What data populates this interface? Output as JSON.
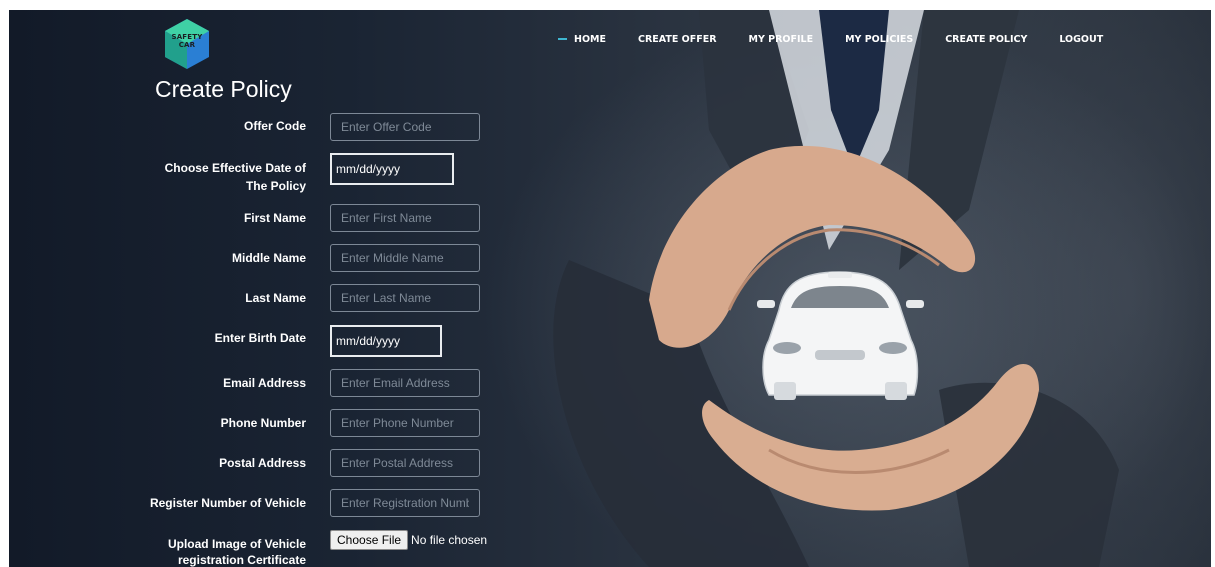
{
  "brand": {
    "logo_text_line1": "SAFETY",
    "logo_text_line2": "CAR"
  },
  "nav": {
    "items": [
      {
        "label": "HOME",
        "active": true
      },
      {
        "label": "CREATE OFFER",
        "active": false
      },
      {
        "label": "MY PROFILE",
        "active": false
      },
      {
        "label": "MY POLICIES",
        "active": false
      },
      {
        "label": "CREATE POLICY",
        "active": false
      },
      {
        "label": "LOGOUT",
        "active": false
      }
    ]
  },
  "page": {
    "title": "Create Policy"
  },
  "form": {
    "offer_code": {
      "label": "Offer Code",
      "placeholder": "Enter Offer Code"
    },
    "effective_date": {
      "label_line1": "Choose Effective Date of",
      "label_line2": "The Policy",
      "value": "mm/dd/yyyy"
    },
    "first_name": {
      "label": "First Name",
      "placeholder": "Enter First Name"
    },
    "middle_name": {
      "label": "Middle Name",
      "placeholder": "Enter Middle Name"
    },
    "last_name": {
      "label": "Last Name",
      "placeholder": "Enter Last Name"
    },
    "birth_date": {
      "label": "Enter Birth Date",
      "value": "mm/dd/yyyy"
    },
    "email": {
      "label": "Email Address",
      "placeholder": "Enter Email Address"
    },
    "phone": {
      "label": "Phone Number",
      "placeholder": "Enter Phone Number"
    },
    "postal": {
      "label": "Postal Address",
      "placeholder": "Enter Postal Address"
    },
    "registration": {
      "label": "Register Number of Vehicle",
      "placeholder": "Enter Registration Numbe"
    },
    "upload": {
      "label_line1": "Upload Image of Vehicle",
      "label_line2": "registration Certificate",
      "button": "Choose File",
      "status": "No file chosen"
    }
  },
  "colors": {
    "accent": "#3fb6d0",
    "logo_teal": "#2fb5a6",
    "logo_blue": "#2a7fd4"
  }
}
